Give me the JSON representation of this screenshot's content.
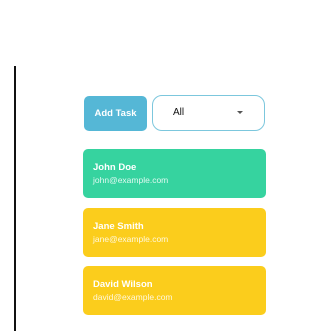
{
  "toolbar": {
    "add_task_label": "Add Task",
    "filter_selected": "All"
  },
  "contacts": [
    {
      "name": "John Doe",
      "email": "john@example.com",
      "color": "#36d39f"
    },
    {
      "name": "Jane Smith",
      "email": "jane@example.com",
      "color": "#fbcd1c"
    },
    {
      "name": "David Wilson",
      "email": "david@example.com",
      "color": "#fbcd1c"
    }
  ],
  "icons": {
    "filter_caret": "chevron-down-icon"
  }
}
